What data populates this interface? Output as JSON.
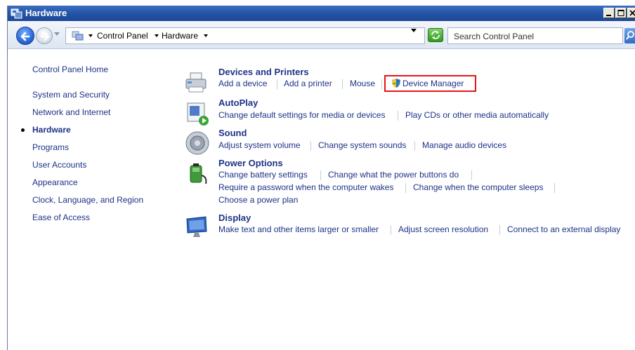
{
  "window": {
    "title": "Hardware"
  },
  "address": {
    "crumbs": [
      "Control Panel",
      "Hardware"
    ],
    "search_placeholder": "Search Control Panel"
  },
  "leftnav": {
    "home": "Control Panel Home",
    "items": [
      "System and Security",
      "Network and Internet",
      "Hardware",
      "Programs",
      "User Accounts",
      "Appearance",
      "Clock, Language, and Region",
      "Ease of Access"
    ],
    "current": "Hardware"
  },
  "categories": [
    {
      "title": "Devices and Printers",
      "icon": "printer-icon",
      "links": [
        "Add a device",
        "Add a printer",
        "Mouse",
        "Device Manager"
      ]
    },
    {
      "title": "AutoPlay",
      "icon": "autoplay-icon",
      "links": [
        "Change default settings for media or devices",
        "Play CDs or other media automatically"
      ]
    },
    {
      "title": "Sound",
      "icon": "speaker-icon",
      "links": [
        "Adjust system volume",
        "Change system sounds",
        "Manage audio devices"
      ]
    },
    {
      "title": "Power Options",
      "icon": "battery-icon",
      "links": [
        "Change battery settings",
        "Change what the power buttons do",
        "Require a password when the computer wakes",
        "Change when the computer sleeps",
        "Choose a power plan"
      ]
    },
    {
      "title": "Display",
      "icon": "monitor-icon",
      "links": [
        "Make text and other items larger or smaller",
        "Adjust screen resolution",
        "Connect to an external display"
      ]
    }
  ],
  "colors": {
    "link": "#1e3287",
    "highlight": "#e8141b",
    "titlebar": "#2556a8"
  }
}
